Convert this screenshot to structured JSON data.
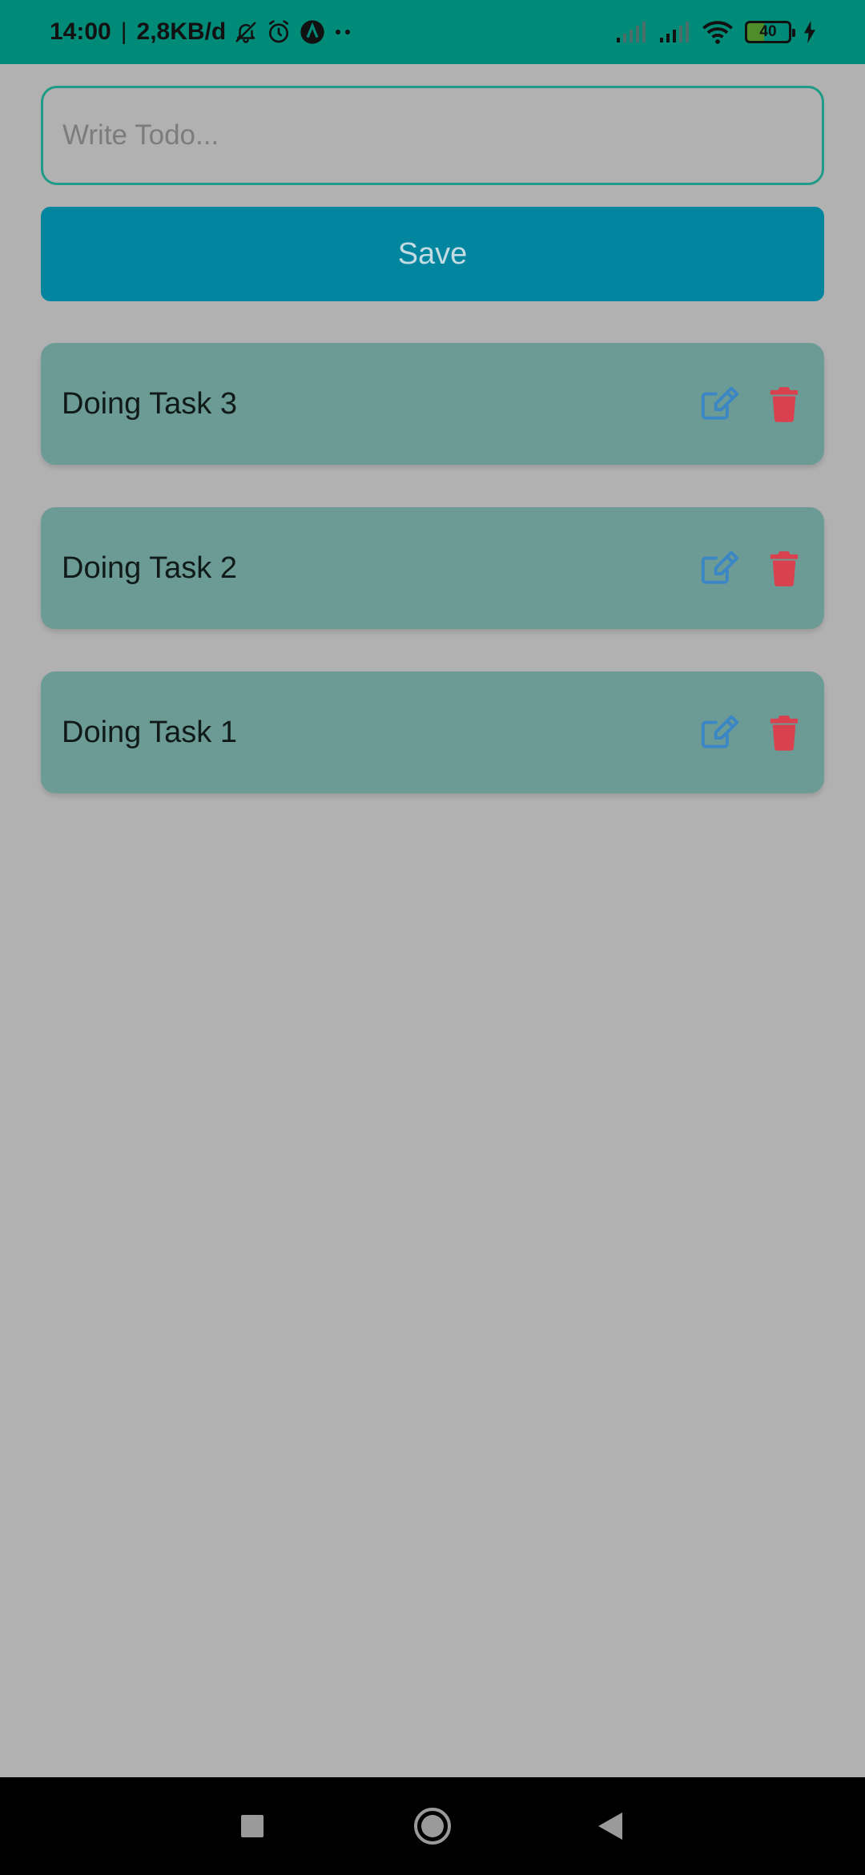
{
  "status_bar": {
    "time": "14:00",
    "separator": "|",
    "network_speed": "2,8KB/d",
    "battery_level": "40",
    "icons": [
      "bell-off-icon",
      "alarm-icon",
      "app-notification-icon",
      "more-dots-icon",
      "signal-icon",
      "signal-icon",
      "wifi-icon",
      "battery-icon",
      "charging-icon"
    ]
  },
  "todo_form": {
    "input_value": "",
    "input_placeholder": "Write Todo...",
    "save_label": "Save"
  },
  "tasks": [
    {
      "label": "Doing Task 3"
    },
    {
      "label": "Doing Task 2"
    },
    {
      "label": "Doing Task 1"
    }
  ],
  "nav_bar": {
    "icons": [
      "recents-square-icon",
      "home-circle-icon",
      "back-triangle-icon"
    ]
  },
  "colors": {
    "status_bar": "#008a78",
    "background": "#b1b1b1",
    "save_button": "#0286a0",
    "task_card": "#6b9b94",
    "edit_icon": "#3b86c4",
    "delete_icon": "#d9414f",
    "input_border": "#1f9b87"
  }
}
